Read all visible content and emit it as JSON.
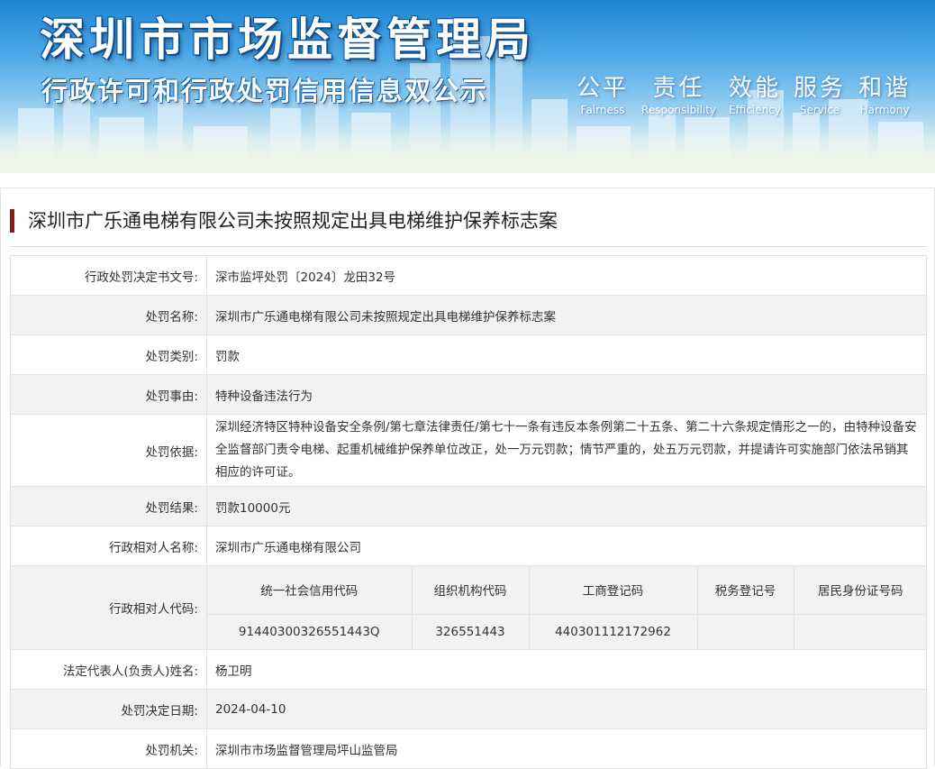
{
  "header": {
    "title": "深圳市市场监督管理局",
    "subtitle": "行政许可和行政处罚信用信息双公示",
    "values": [
      {
        "cn": "公平",
        "en": "Fairness"
      },
      {
        "cn": "责任",
        "en": "Responsibility"
      },
      {
        "cn": "效能",
        "en": "Efficiency"
      },
      {
        "cn": "服务",
        "en": "Service"
      },
      {
        "cn": "和谐",
        "en": "Harmony"
      }
    ]
  },
  "page": {
    "title": "深圳市广乐通电梯有限公司未按照规定出具电梯维护保养标志案"
  },
  "rows": {
    "decision_no": {
      "label": "行政处罚决定书文号:",
      "value": "深市监坪处罚〔2024〕龙田32号"
    },
    "penalty_name": {
      "label": "处罚名称:",
      "value": "深圳市广乐通电梯有限公司未按照规定出具电梯维护保养标志案"
    },
    "penalty_type": {
      "label": "处罚类别:",
      "value": "罚款"
    },
    "penalty_reason": {
      "label": "处罚事由:",
      "value": "特种设备违法行为"
    },
    "penalty_basis": {
      "label": "处罚依据:",
      "value": "深圳经济特区特种设备安全条例/第七章法律责任/第七十一条有违反本条例第二十五条、第二十六条规定情形之一的，由特种设备安全监督部门责令电梯、起重机械维护保养单位改正，处一万元罚款；情节严重的，处五万元罚款，并提请许可实施部门依法吊销其相应的许可证。"
    },
    "penalty_result": {
      "label": "处罚结果:",
      "value": "罚款10000元"
    },
    "party_name": {
      "label": "行政相对人名称:",
      "value": "深圳市广乐通电梯有限公司"
    },
    "party_code": {
      "label": "行政相对人代码:",
      "headers": [
        "统一社会信用代码",
        "组织机构代码",
        "工商登记码",
        "税务登记号",
        "居民身份证号码"
      ],
      "values": [
        "91440300326551443Q",
        "326551443",
        "440301112172962",
        "",
        ""
      ]
    },
    "legal_rep": {
      "label": "法定代表人(负责人)姓名:",
      "value": "杨卫明"
    },
    "decision_date": {
      "label": "处罚决定日期:",
      "value": "2024-04-10"
    },
    "authority": {
      "label": "处罚机关:",
      "value": "深圳市市场监督管理局坪山监管局"
    }
  }
}
